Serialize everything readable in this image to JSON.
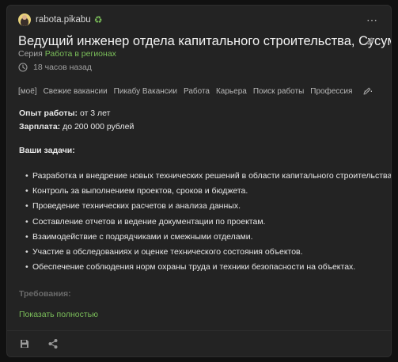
{
  "community": {
    "name": "rabota.pikabu"
  },
  "post": {
    "title": "Ведущий инженер отдела капитального строительства, Сусуман",
    "series_label": "Серия",
    "series_name": "Работа в регионах",
    "time": "18 часов назад"
  },
  "tags": [
    "[моё]",
    "Свежие вакансии",
    "Пикабу Вакансии",
    "Работа",
    "Карьера",
    "Поиск работы",
    "Профессия"
  ],
  "content": {
    "experience_label": "Опыт работы:",
    "experience_value": " от 3 лет",
    "salary_label": "Зарплата:",
    "salary_value": " до 200 000 рублей",
    "tasks_heading": "Ваши задачи:",
    "tasks": [
      "Разработка и внедрение новых технических решений в области капитального строительства.",
      "Контроль за выполнением проектов, сроков и бюджета.",
      "Проведение технических расчетов и анализа данных.",
      "Составление отчетов и ведение документации по проектам.",
      "Взаимодействие с подрядчиками и смежными отделами.",
      "Участие в обследованиях и оценке технического состояния объектов.",
      "Обеспечение соблюдения норм охраны труда и техники безопасности на объектах."
    ],
    "requirements_heading": "Требования:"
  },
  "show_more": "Показать полностью",
  "colors": {
    "accent": "#7bbf5a",
    "card": "#232323",
    "background": "#111111"
  },
  "icons": [
    "avatar",
    "recycle-icon",
    "more-icon",
    "link-icon",
    "clock-icon",
    "pencil-icon",
    "save-icon",
    "share-icon"
  ]
}
